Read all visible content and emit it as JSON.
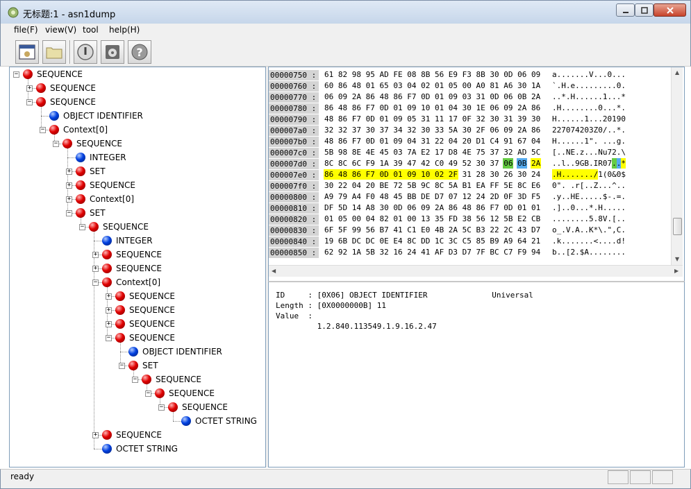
{
  "window": {
    "title": "无标题:1 - asn1dump"
  },
  "menu": [
    "file(F)",
    "view(V)",
    "tool",
    "help(H)"
  ],
  "toolbar": [
    {
      "name": "view-button",
      "icon": "window-view-icon"
    },
    {
      "name": "open-button",
      "icon": "folder-icon"
    },
    {
      "name": "power-button",
      "icon": "power-icon"
    },
    {
      "name": "disk-button",
      "icon": "disk-icon"
    },
    {
      "name": "help-button",
      "icon": "question-icon"
    }
  ],
  "tree": [
    {
      "label": "SEQUENCE",
      "depth": 0,
      "color": "red",
      "toggle": "-"
    },
    {
      "label": "SEQUENCE",
      "depth": 1,
      "color": "red",
      "toggle": "+"
    },
    {
      "label": "SEQUENCE",
      "depth": 1,
      "color": "red",
      "toggle": "-"
    },
    {
      "label": "OBJECT IDENTIFIER",
      "depth": 2,
      "color": "blue",
      "toggle": ""
    },
    {
      "label": "Context[0]",
      "depth": 2,
      "color": "red",
      "toggle": "-"
    },
    {
      "label": "SEQUENCE",
      "depth": 3,
      "color": "red",
      "toggle": "-"
    },
    {
      "label": "INTEGER",
      "depth": 4,
      "color": "blue",
      "toggle": ""
    },
    {
      "label": "SET",
      "depth": 4,
      "color": "red",
      "toggle": "+"
    },
    {
      "label": "SEQUENCE",
      "depth": 4,
      "color": "red",
      "toggle": "+"
    },
    {
      "label": "Context[0]",
      "depth": 4,
      "color": "red",
      "toggle": "+"
    },
    {
      "label": "SET",
      "depth": 4,
      "color": "red",
      "toggle": "-"
    },
    {
      "label": "SEQUENCE",
      "depth": 5,
      "color": "red",
      "toggle": "-"
    },
    {
      "label": "INTEGER",
      "depth": 6,
      "color": "blue",
      "toggle": ""
    },
    {
      "label": "SEQUENCE",
      "depth": 6,
      "color": "red",
      "toggle": "+"
    },
    {
      "label": "SEQUENCE",
      "depth": 6,
      "color": "red",
      "toggle": "+"
    },
    {
      "label": "Context[0]",
      "depth": 6,
      "color": "red",
      "toggle": "-"
    },
    {
      "label": "SEQUENCE",
      "depth": 7,
      "color": "red",
      "toggle": "+"
    },
    {
      "label": "SEQUENCE",
      "depth": 7,
      "color": "red",
      "toggle": "+"
    },
    {
      "label": "SEQUENCE",
      "depth": 7,
      "color": "red",
      "toggle": "+"
    },
    {
      "label": "SEQUENCE",
      "depth": 7,
      "color": "red",
      "toggle": "-"
    },
    {
      "label": "OBJECT IDENTIFIER",
      "depth": 8,
      "color": "blue",
      "toggle": ""
    },
    {
      "label": "SET",
      "depth": 8,
      "color": "red",
      "toggle": "-"
    },
    {
      "label": "SEQUENCE",
      "depth": 9,
      "color": "red",
      "toggle": "-"
    },
    {
      "label": "SEQUENCE",
      "depth": 10,
      "color": "red",
      "toggle": "-"
    },
    {
      "label": "SEQUENCE",
      "depth": 11,
      "color": "red",
      "toggle": "-"
    },
    {
      "label": "OCTET STRING",
      "depth": 12,
      "color": "blue",
      "toggle": ""
    },
    {
      "label": "SEQUENCE",
      "depth": 6,
      "color": "red",
      "toggle": "+"
    },
    {
      "label": "OCTET STRING",
      "depth": 6,
      "color": "blue",
      "toggle": ""
    }
  ],
  "hex": [
    {
      "addr": "00000750",
      "bytes": "61 82 98 95 AD FE 08 8B 56 E9 F3 8B 30 0D 06 09",
      "ascii": "a.......V...0..."
    },
    {
      "addr": "00000760",
      "bytes": "60 86 48 01 65 03 04 02 01 05 00 A0 81 A6 30 1A",
      "ascii": "`.H.e.........0."
    },
    {
      "addr": "00000770",
      "bytes": "06 09 2A 86 48 86 F7 0D 01 09 03 31 0D 06 0B 2A",
      "ascii": "..*.H......1...*"
    },
    {
      "addr": "00000780",
      "bytes": "86 48 86 F7 0D 01 09 10 01 04 30 1E 06 09 2A 86",
      "ascii": ".H........0...*."
    },
    {
      "addr": "00000790",
      "bytes": "48 86 F7 0D 01 09 05 31 11 17 0F 32 30 31 39 30",
      "ascii": "H......1...20190"
    },
    {
      "addr": "000007a0",
      "bytes": "32 32 37 30 37 34 32 30 33 5A 30 2F 06 09 2A 86",
      "ascii": "227074203Z0/..*."
    },
    {
      "addr": "000007b0",
      "bytes": "48 86 F7 0D 01 09 04 31 22 04 20 D1 C4 91 67 04",
      "ascii": "H......1\". ...g."
    },
    {
      "addr": "000007c0",
      "bytes": "5B 98 8E 4E 45 03 7A E2 17 D8 4E 75 37 32 AD 5C",
      "ascii": "[..NE.z...Nu72.\\"
    },
    {
      "addr": "000007d0",
      "bytes": "8C 8C 6C F9 1A 39 47 42 C0 49 52 30 37 06 0B 2A",
      "ascii": "..l..9GB.IR07..*"
    },
    {
      "addr": "000007e0",
      "bytes": "86 48 86 F7 0D 01 09 10 02 2F 31 28 30 26 30 24",
      "ascii": ".H......./1(0&0$"
    },
    {
      "addr": "000007f0",
      "bytes": "30 22 04 20 BE 72 5B 9C 8C 5A B1 EA FF 5E 8C E6",
      "ascii": "0\". .r[..Z...^.."
    },
    {
      "addr": "00000800",
      "bytes": "A9 79 A4 F0 48 45 BB DE D7 07 12 24 2D 0F 3D F5",
      "ascii": ".y..HE.....$-.=."
    },
    {
      "addr": "00000810",
      "bytes": "DF 5D 14 A8 30 0D 06 09 2A 86 48 86 F7 0D 01 01",
      "ascii": ".]..0...*.H....."
    },
    {
      "addr": "00000820",
      "bytes": "01 05 00 04 82 01 00 13 35 FD 38 56 12 5B E2 CB",
      "ascii": "........5.8V.[.."
    },
    {
      "addr": "00000830",
      "bytes": "6F 5F 99 56 B7 41 C1 E0 4B 2A 5C B3 22 2C 43 D7",
      "ascii": "o_.V.A..K*\\.\",C."
    },
    {
      "addr": "00000840",
      "bytes": "19 6B DC DC 0E E4 8C DD 1C 3C C5 85 B9 A9 64 21",
      "ascii": ".k.......<....d!"
    },
    {
      "addr": "00000850",
      "bytes": "62 92 1A 5B 32 16 24 41 AF D3 D7 7F BC C7 F9 94",
      "ascii": "b..[2.$A........"
    }
  ],
  "detail": {
    "line1": "ID     : [0X06] OBJECT IDENTIFIER              Universal",
    "line2": "Length : [0X0000000B] 11",
    "line3": "Value  :",
    "line4": "         1.2.840.113549.1.9.16.2.47"
  },
  "status": {
    "text": "ready"
  },
  "colors": {
    "highlight_selected": "#ffff00",
    "highlight_tag": "#66cc44",
    "highlight_length": "#55aaee"
  }
}
